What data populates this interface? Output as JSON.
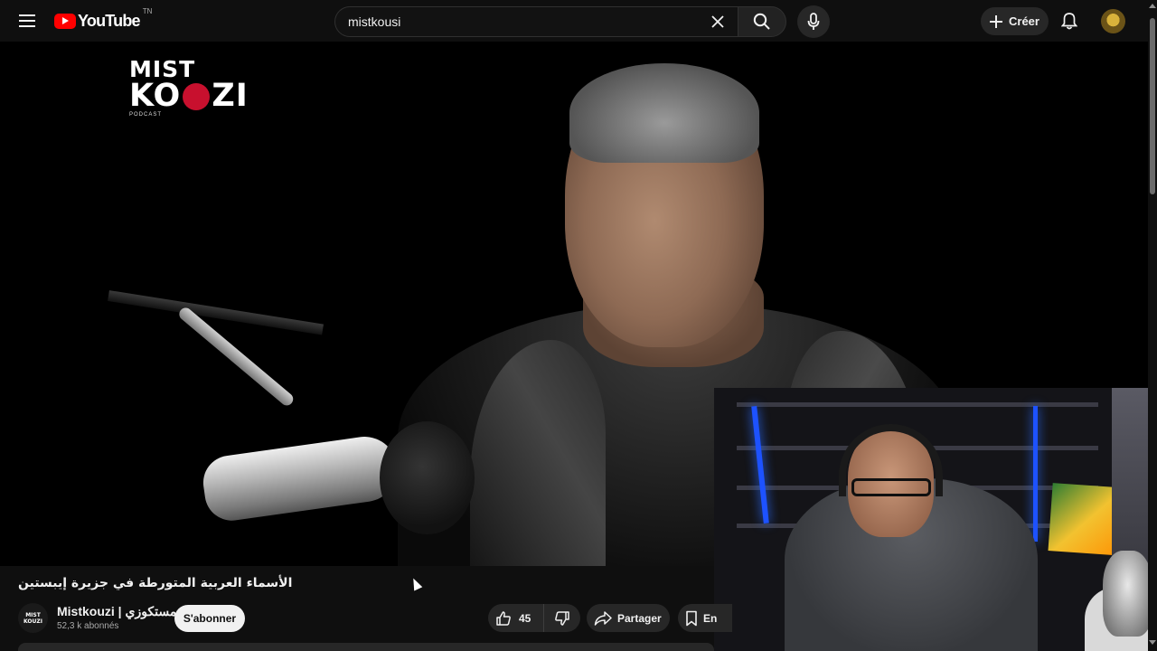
{
  "header": {
    "logo_text": "YouTube",
    "country_code": "TN",
    "search_value": "mistkousi",
    "create_label": "Créer"
  },
  "video": {
    "overlay_brand_line1": "MIST",
    "overlay_brand_line2_left": "KO",
    "overlay_brand_line2_right": "ZI",
    "overlay_brand_sub": "PODCAST",
    "title": "الأسماء العربية المتورطة في جزيرة إيبستين"
  },
  "channel": {
    "avatar_text_line1": "MIST",
    "avatar_text_line2": "KOUZI",
    "name": "Mistkouzi | مستكوزي",
    "subscribers": "52,3 k abonnés",
    "subscribe_label": "S'abonner"
  },
  "actions": {
    "like_count": "45",
    "share_label": "Partager",
    "save_label": "En"
  },
  "colors": {
    "background": "#0f0f0f",
    "accent": "#ff0000",
    "button_bg": "#272727"
  },
  "icons": [
    "menu-icon",
    "youtube-play-icon",
    "clear-icon",
    "search-icon",
    "microphone-icon",
    "plus-icon",
    "bell-icon",
    "thumbs-up-icon",
    "thumbs-down-icon",
    "share-icon",
    "bookmark-icon"
  ]
}
